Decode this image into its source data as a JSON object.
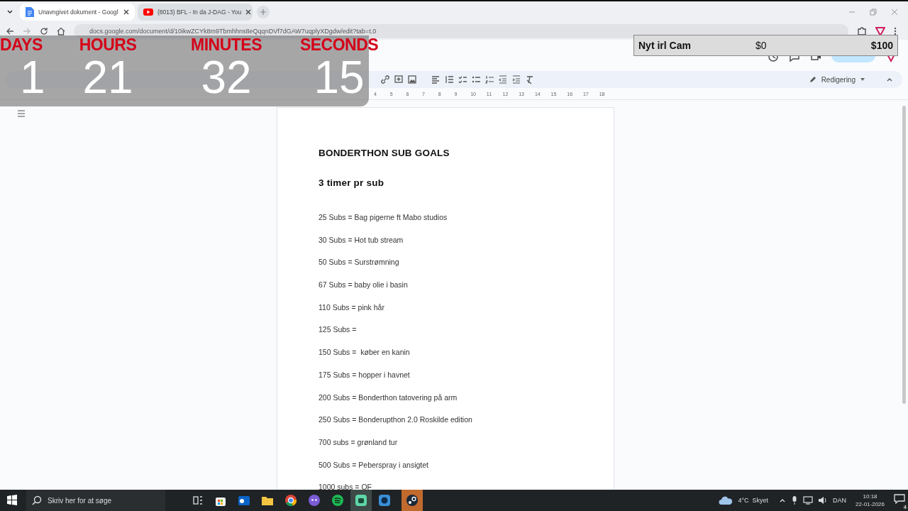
{
  "browser": {
    "tabs": [
      {
        "title": "Unavngivet dokument - Googl",
        "kind": "docs",
        "selected": true
      },
      {
        "title": "(8013) BFL - In da J-DAG - You",
        "kind": "youtube",
        "selected": false
      }
    ],
    "url": "docs.google.com/document/d/10ikwZCYk8m9Tbmhhns8eQqqnDVf7dGAW7uqplyXDgdw/edit?tab=t.0"
  },
  "docs": {
    "mode": "Redigering",
    "ruler": [
      "4",
      "5",
      "6",
      "7",
      "8",
      "9",
      "10",
      "11",
      "12",
      "13",
      "14",
      "15",
      "16",
      "17",
      "18"
    ],
    "heading": "BONDERTHON SUB GOALS",
    "subheading": "3 timer pr sub",
    "lines": [
      "25 Subs = Bag pigerne ft Mabo studios",
      "30 Subs = Hot tub stream",
      "50 Subs = Surstrømning",
      "67 Subs = baby olie i basin",
      "110 Subs = pink hår",
      "125 Subs =",
      "150 Subs =  køber en kanin",
      "175 Subs = hopper i havnet",
      "200 Subs = Bonderthon tatovering på arm",
      "250 Subs = Bonderupthon 2.0 Roskilde edition",
      "700 subs = grønland tur",
      "500 Subs = Peberspray i ansigtet",
      "1000 subs = OF"
    ]
  },
  "timer": [
    {
      "label": "DAYS",
      "value": "1"
    },
    {
      "label": "HOURS",
      "value": "21"
    },
    {
      "label": "MINUTES",
      "value": "32"
    },
    {
      "label": "SECONDS",
      "value": "15"
    }
  ],
  "goal": {
    "title": "Nyt irl Cam",
    "current": "$0",
    "target": "$100",
    "level": 0
  },
  "taskbar": {
    "search_placeholder": "Skriv her for at søge",
    "weather": "4°C  Skyet",
    "language": "DAN",
    "time": "10:18",
    "date": "22-01-2026",
    "notifications": "4"
  }
}
